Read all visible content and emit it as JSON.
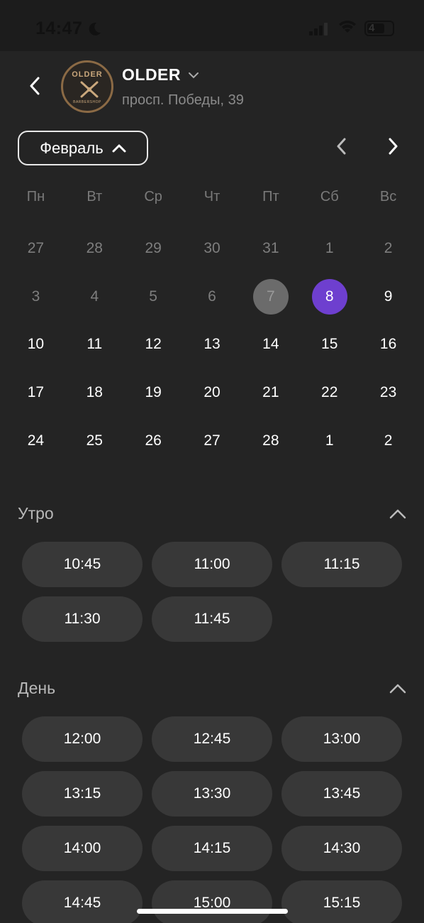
{
  "status": {
    "time": "14:47",
    "battery": "4"
  },
  "header": {
    "shop_name": "OLDER",
    "address": "просп. Победы, 39",
    "logo_text": "OLDER",
    "logo_sub": "BARBERSHOP"
  },
  "calendar": {
    "month": "Февраль",
    "weekdays": [
      "Пн",
      "Вт",
      "Ср",
      "Чт",
      "Пт",
      "Сб",
      "Вс"
    ],
    "days": [
      {
        "n": "27",
        "s": "muted"
      },
      {
        "n": "28",
        "s": "muted"
      },
      {
        "n": "29",
        "s": "muted"
      },
      {
        "n": "30",
        "s": "muted"
      },
      {
        "n": "31",
        "s": "muted"
      },
      {
        "n": "1",
        "s": "muted"
      },
      {
        "n": "2",
        "s": "muted"
      },
      {
        "n": "3",
        "s": "muted"
      },
      {
        "n": "4",
        "s": "muted"
      },
      {
        "n": "5",
        "s": "muted"
      },
      {
        "n": "6",
        "s": "muted"
      },
      {
        "n": "7",
        "s": "today"
      },
      {
        "n": "8",
        "s": "selected"
      },
      {
        "n": "9",
        "s": ""
      },
      {
        "n": "10",
        "s": ""
      },
      {
        "n": "11",
        "s": ""
      },
      {
        "n": "12",
        "s": ""
      },
      {
        "n": "13",
        "s": ""
      },
      {
        "n": "14",
        "s": ""
      },
      {
        "n": "15",
        "s": ""
      },
      {
        "n": "16",
        "s": ""
      },
      {
        "n": "17",
        "s": ""
      },
      {
        "n": "18",
        "s": ""
      },
      {
        "n": "19",
        "s": ""
      },
      {
        "n": "20",
        "s": ""
      },
      {
        "n": "21",
        "s": ""
      },
      {
        "n": "22",
        "s": ""
      },
      {
        "n": "23",
        "s": ""
      },
      {
        "n": "24",
        "s": ""
      },
      {
        "n": "25",
        "s": ""
      },
      {
        "n": "26",
        "s": ""
      },
      {
        "n": "27",
        "s": ""
      },
      {
        "n": "28",
        "s": ""
      },
      {
        "n": "1",
        "s": ""
      },
      {
        "n": "2",
        "s": ""
      }
    ],
    "selected_color": "#6e3fcf"
  },
  "morning": {
    "title": "Утро",
    "slots": [
      "10:45",
      "11:00",
      "11:15",
      "11:30",
      "11:45"
    ]
  },
  "day": {
    "title": "День",
    "slots": [
      "12:00",
      "12:45",
      "13:00",
      "13:15",
      "13:30",
      "13:45",
      "14:00",
      "14:15",
      "14:30",
      "14:45",
      "15:00",
      "15:15"
    ]
  }
}
